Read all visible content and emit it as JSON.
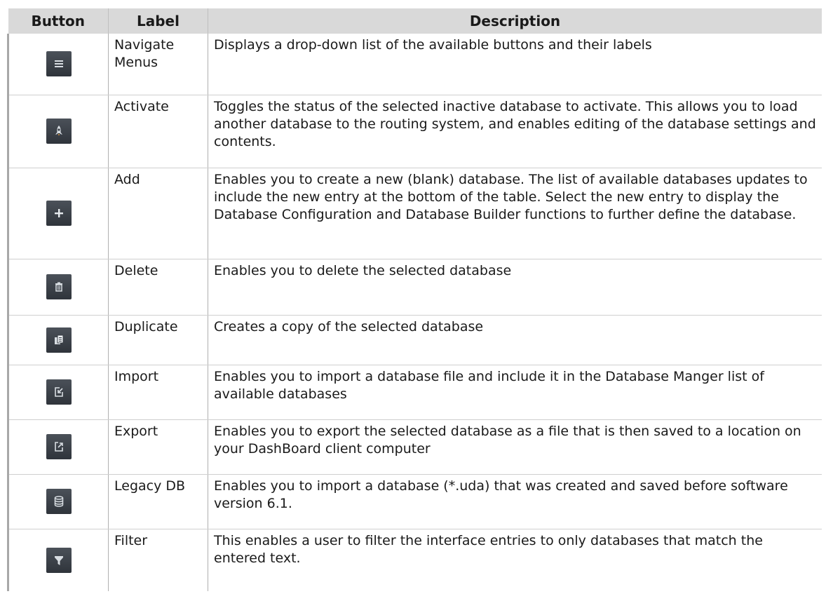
{
  "table": {
    "headers": {
      "button": "Button",
      "label": "Label",
      "description": "Description"
    },
    "rows": [
      {
        "icon": "menu-icon",
        "label": "Navigate Menus",
        "description": "Displays a drop-down list of the available buttons and their labels"
      },
      {
        "icon": "rocket-icon",
        "label": "Activate",
        "description": "Toggles the status of the selected inactive database to activate. This allows you to load another database to the routing system, and enables editing of the database settings and contents."
      },
      {
        "icon": "plus-icon",
        "label": "Add",
        "description": "Enables you to create a new (blank) database. The list of available databases updates to include the new entry at the bottom of the table. Select the new entry to display the Database Configuration and Database Builder functions to further define the database."
      },
      {
        "icon": "trash-icon",
        "label": "Delete",
        "description": "Enables you to delete the selected database"
      },
      {
        "icon": "duplicate-icon",
        "label": "Duplicate",
        "description": "Creates a copy of the selected database"
      },
      {
        "icon": "import-icon",
        "label": "Import",
        "description": "Enables you to import a database file and include it in the Database Manger list of available databases"
      },
      {
        "icon": "export-icon",
        "label": "Export",
        "description": "Enables you to export the selected database as a file that is then saved to a location on your DashBoard client computer"
      },
      {
        "icon": "database-icon",
        "label": "Legacy DB",
        "description": "Enables you to import a database (*.uda) that was created and saved before software version 6.1."
      },
      {
        "icon": "filter-icon",
        "label": "Filter",
        "description": "This enables a user to filter the interface entries to only databases that match the entered text."
      }
    ]
  }
}
